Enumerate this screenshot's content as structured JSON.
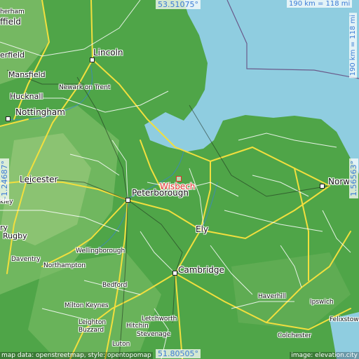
{
  "map": {
    "coordinates": {
      "top": "53.51075°",
      "bottom": "51.80505°",
      "left": "-1.24687°",
      "right": "1.56563°"
    },
    "scale": {
      "horizontal": "190 km = 118 mi",
      "vertical": "190 km = 118 mi"
    },
    "attribution_left": "map data: openstreetmap, style: opentopomap",
    "attribution_right": "image: elevation.city",
    "target_place": "Wisbech",
    "places": {
      "lincoln": "Lincoln",
      "mansfield": "Mansfield",
      "newark": "Newark on Trent",
      "hucknall": "Hucknall",
      "nottingham": "Nottingham",
      "leicester": "Leicester",
      "peterborough": "Peterborough",
      "ely": "Ely",
      "norwich": "Norw",
      "rugby": "Rugby",
      "wellingborough": "Wellingborough",
      "daventry": "Daventry",
      "northampton": "Northampton",
      "cambridge": "Cambridge",
      "bedford": "Bedford",
      "haverhill": "Haverhill",
      "ipswich": "Ipswich",
      "milton_keynes": "Milton Keynes",
      "letchworth": "Letchworth",
      "hitchin": "Hitchin",
      "leighton": "Leighton",
      "buzzard": "Buzzard",
      "stevenage": "Stevenage",
      "luton": "Luton",
      "felixstowe": "Felixstowe",
      "colchester": "Colchester",
      "edge_sheffield": "ffield",
      "edge_chesterfield": "erfield",
      "edge_rotherham": "herham",
      "edge_loughborough": "ry",
      "edge_hinckley": "kley"
    },
    "colors": {
      "sea": "#8fcde0",
      "land_low": "#4fa548",
      "land_high": "#9ccc7e",
      "coordinate_text": "#3b7bd6",
      "target": "#e0302a",
      "major_road": "#f2df3e",
      "minor_road": "#ffffff"
    }
  }
}
